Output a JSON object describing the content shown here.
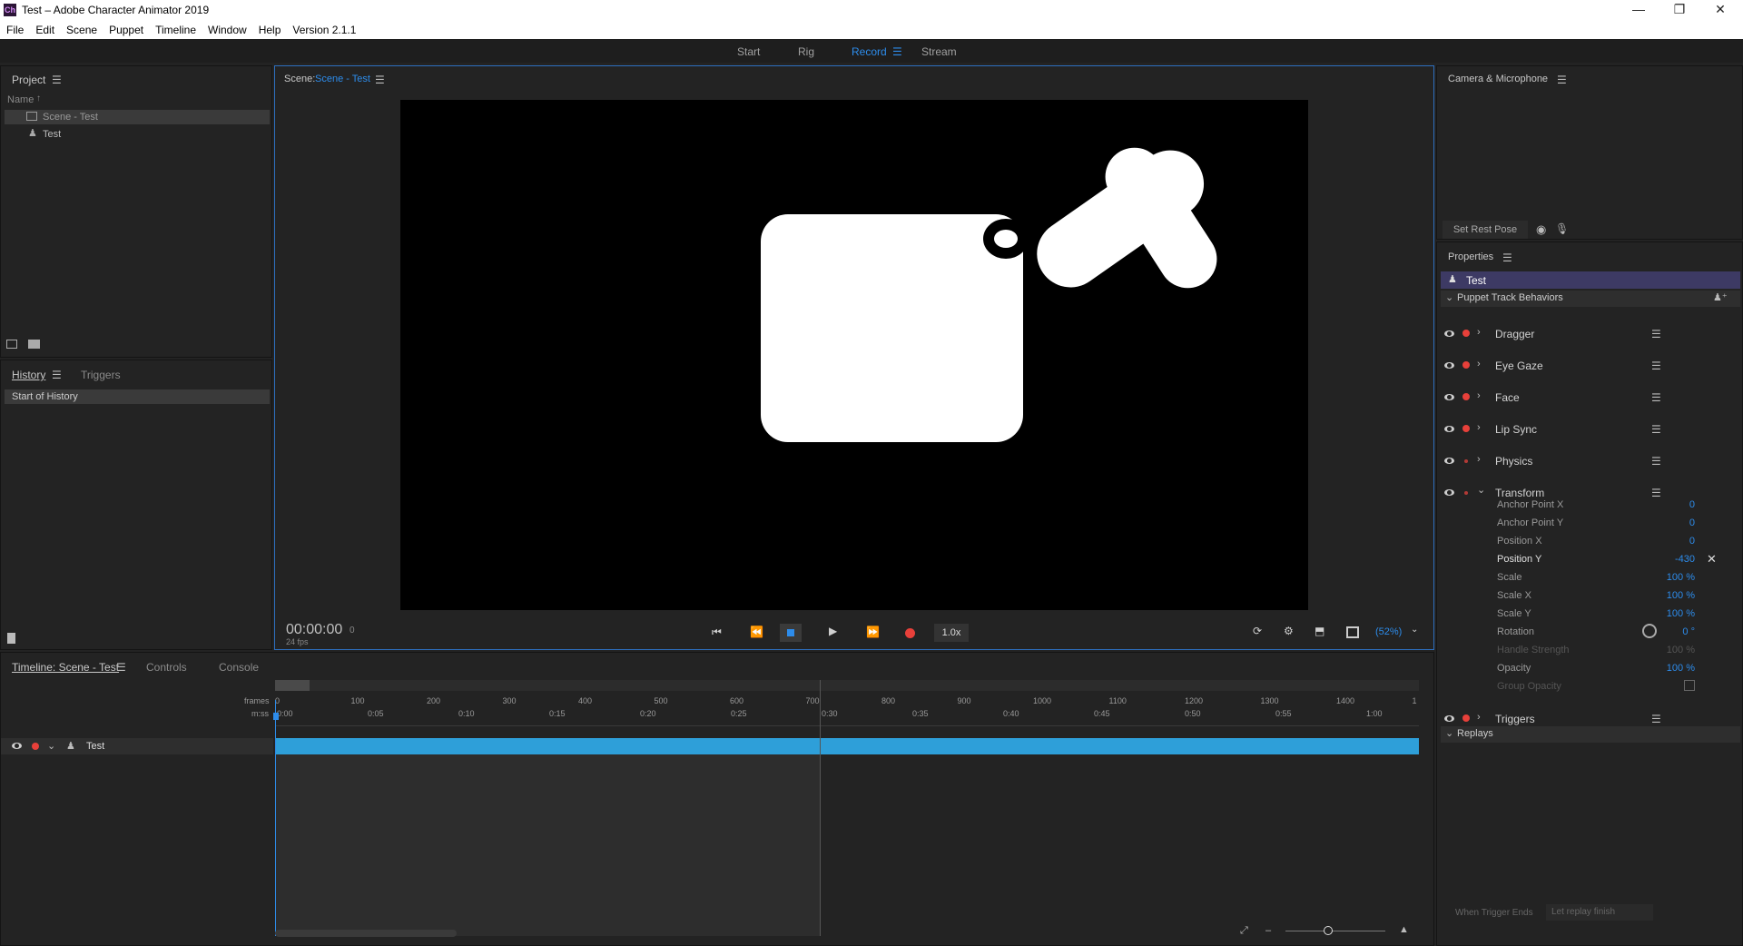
{
  "window": {
    "title": "Test – Adobe Character Animator 2019",
    "logo": "Ch",
    "min": "—",
    "restore": "❐",
    "close": "✕"
  },
  "menu": [
    "File",
    "Edit",
    "Scene",
    "Puppet",
    "Timeline",
    "Window",
    "Help",
    "Version 2.1.1"
  ],
  "workspace": {
    "tabs": [
      "Start",
      "Rig",
      "Record",
      "Stream"
    ],
    "active": "Record"
  },
  "project": {
    "title": "Project",
    "column": "Name",
    "sort": "↑",
    "items": [
      {
        "name": "Scene - Test",
        "icon": "scene-icon",
        "selected": true
      },
      {
        "name": "Test",
        "icon": "puppet-icon",
        "selected": false
      }
    ]
  },
  "history": {
    "tabs": [
      "History",
      "Triggers"
    ],
    "items": [
      "Start of History"
    ]
  },
  "scene": {
    "label": "Scene:",
    "name": "Scene - Test",
    "timecode": "00:00:00",
    "frame": "0",
    "fps": "24 fps",
    "speed": "1.0x",
    "zoom": "(52%)"
  },
  "timeline": {
    "tabs": [
      "Timeline: Scene - Test",
      "Controls",
      "Console"
    ],
    "rows_label_frames": "frames",
    "rows_label_mss": "m:ss",
    "frames": [
      "0",
      "100",
      "200",
      "300",
      "400",
      "500",
      "600",
      "700",
      "800",
      "900",
      "1000",
      "1100",
      "1200",
      "1300",
      "1400",
      "1"
    ],
    "times": [
      "0:00",
      "0:05",
      "0:10",
      "0:15",
      "0:20",
      "0:25",
      "0:30",
      "0:35",
      "0:40",
      "0:45",
      "0:50",
      "0:55",
      "1:00"
    ],
    "track": "Test"
  },
  "camera": {
    "title": "Camera & Microphone",
    "rest_pose": "Set Rest Pose"
  },
  "properties": {
    "title": "Properties",
    "puppet": "Test",
    "section": "Puppet Track Behaviors",
    "behaviors": [
      "Dragger",
      "Eye Gaze",
      "Face",
      "Lip Sync",
      "Physics",
      "Transform"
    ],
    "transform_params": [
      {
        "name": "Anchor Point X",
        "value": "0"
      },
      {
        "name": "Anchor Point Y",
        "value": "0"
      },
      {
        "name": "Position X",
        "value": "0"
      },
      {
        "name": "Position Y",
        "value": "-430"
      },
      {
        "name": "Scale",
        "value": "100 %"
      },
      {
        "name": "Scale X",
        "value": "100 %"
      },
      {
        "name": "Scale Y",
        "value": "100 %"
      },
      {
        "name": "Rotation",
        "value": "0 °"
      },
      {
        "name": "Handle Strength",
        "value": "100 %"
      },
      {
        "name": "Opacity",
        "value": "100 %"
      },
      {
        "name": "Group Opacity",
        "value": ""
      }
    ],
    "triggers": "Triggers",
    "replays": "Replays",
    "trigger_end_label": "When Trigger Ends",
    "trigger_end_value": "Let replay finish"
  }
}
